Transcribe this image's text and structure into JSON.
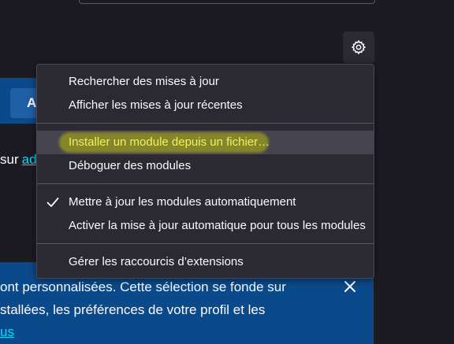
{
  "page": {
    "button_label": "A",
    "text_prefix": "sur",
    "text_link": "ad"
  },
  "notice": {
    "line1": "ont personnalisées. Cette sélection se fonde sur",
    "line2": "stallées, les préférences de votre profil et les",
    "line3": "us"
  },
  "menu": {
    "items": [
      {
        "label": "Rechercher des mises à jour"
      },
      {
        "label": "Afficher les mises à jour récentes"
      },
      {
        "label": "Installer un module depuis un fichier…",
        "highlighted": true
      },
      {
        "label": "Déboguer des modules"
      },
      {
        "label": "Mettre à jour les modules automatiquement",
        "checked": true
      },
      {
        "label": "Activer la mise à jour automatique pour tous les modules"
      },
      {
        "label": "Gérer les raccourcis d’extensions"
      }
    ]
  },
  "icons": {
    "settings": "gear-icon",
    "close": "close-icon",
    "check": "checkmark-icon"
  },
  "colors": {
    "background": "#1c1b22",
    "menu_background": "#2b2a33",
    "notice_background": "#0b4a8a",
    "link": "#00ddff",
    "highlight": "#d2d800"
  }
}
